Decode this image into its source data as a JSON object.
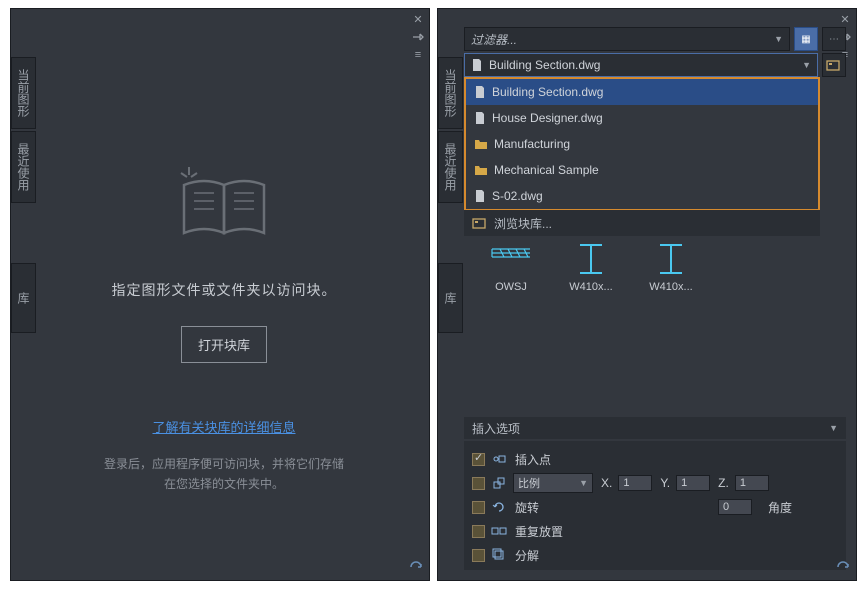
{
  "left": {
    "tabs": {
      "current": "当前图形",
      "recent": "最近使用",
      "library": "库"
    },
    "empty_message": "指定图形文件或文件夹以访问块。",
    "open_button": "打开块库",
    "learn_link": "了解有关块库的详细信息",
    "login_text": "登录后，应用程序便可访问块，并将它们存储\n在您选择的文件夹中。"
  },
  "right": {
    "tabs": {
      "current": "当前图形",
      "recent": "最近使用",
      "library": "库"
    },
    "filter_label": "过滤器...",
    "current_file": "Building Section.dwg",
    "dropdown": [
      {
        "type": "file",
        "label": "Building Section.dwg"
      },
      {
        "type": "file",
        "label": "House Designer.dwg"
      },
      {
        "type": "folder",
        "label": "Manufacturing"
      },
      {
        "type": "folder",
        "label": "Mechanical Sample"
      },
      {
        "type": "file",
        "label": "S-02.dwg"
      }
    ],
    "browse": "浏览块库...",
    "thumbs": [
      {
        "label": "OWSJ"
      },
      {
        "label": "W410x..."
      },
      {
        "label": "W410x..."
      }
    ],
    "insert": {
      "header": "插入选项",
      "insertion_point": "插入点",
      "scale_label": "比例",
      "x": "X.",
      "y": "Y.",
      "z": "Z.",
      "xv": "1",
      "yv": "1",
      "zv": "1",
      "rotate": "旋转",
      "rotate_val": "0",
      "angle": "角度",
      "repeat": "重复放置",
      "explode": "分解"
    }
  }
}
